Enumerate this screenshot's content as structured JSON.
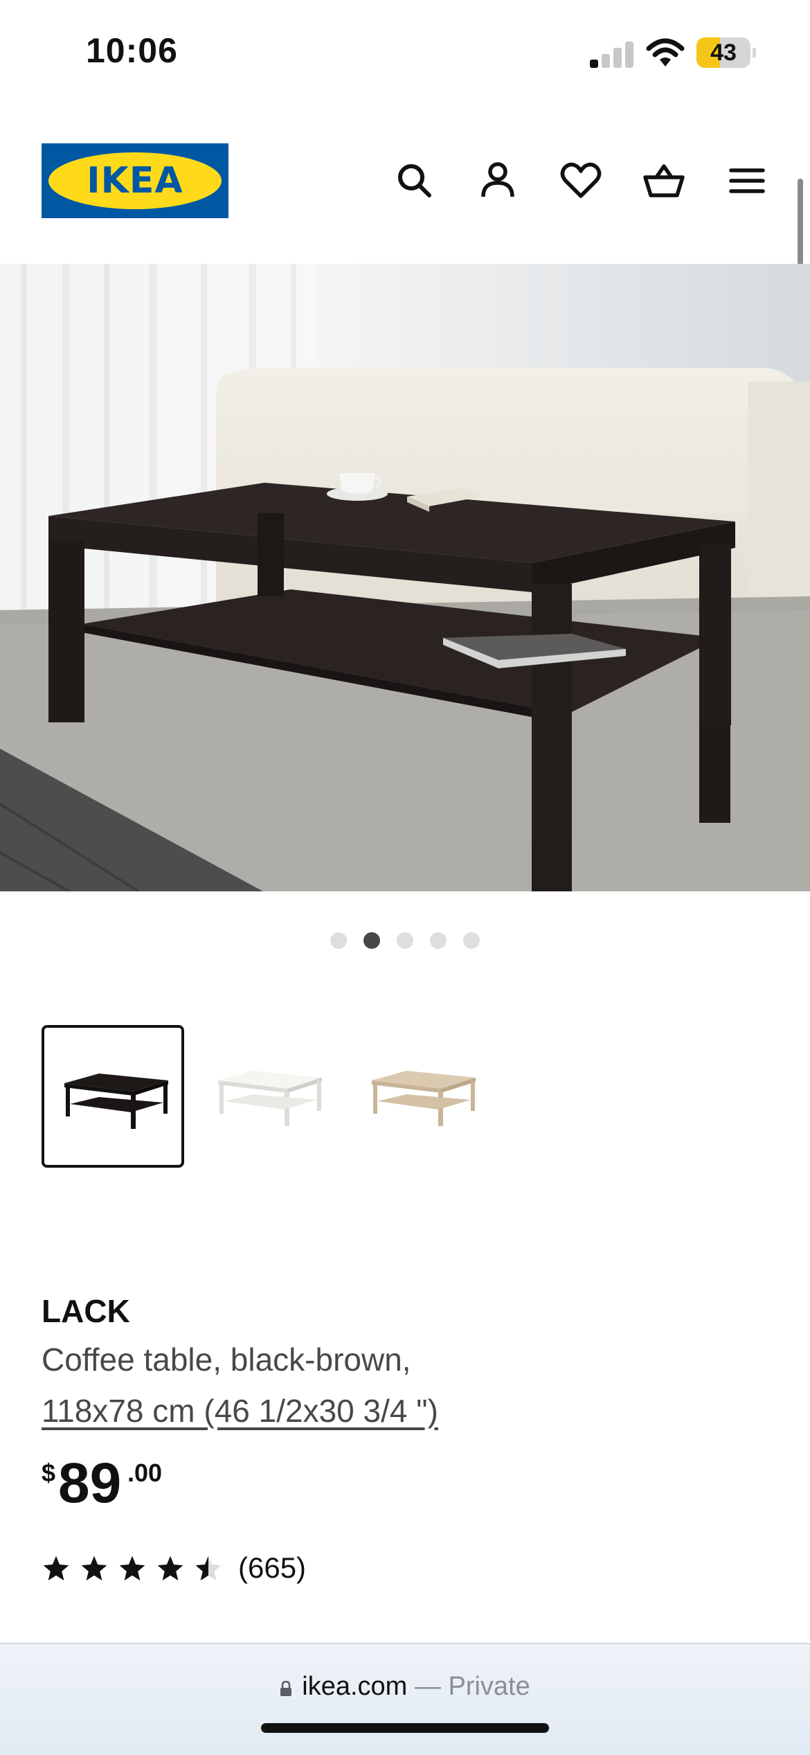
{
  "status_bar": {
    "time": "10:06",
    "battery_percent": "43",
    "signal_bars_active": 1,
    "battery_level": 0.43
  },
  "header": {
    "logo_text": "IKEA",
    "colors": {
      "brand_blue": "#0058a3",
      "brand_yellow": "#ffda1a"
    },
    "icons": [
      "search-icon",
      "account-icon",
      "wishlist-heart-icon",
      "cart-basket-icon",
      "menu-icon"
    ]
  },
  "gallery": {
    "image_count": 5,
    "active_index": 1
  },
  "variants": [
    {
      "name": "black-brown",
      "color": "#2a2421",
      "selected": true
    },
    {
      "name": "white",
      "color": "#f2f0ea",
      "selected": false
    },
    {
      "name": "white stained oak",
      "color": "#d8c4a8",
      "selected": false
    }
  ],
  "product": {
    "name": "LACK",
    "description": "Coffee table, black-brown,",
    "size": "118x78 cm (46 1/2x30 3/4 \")",
    "price": {
      "currency": "$",
      "integer": "89",
      "decimal": ".00"
    },
    "rating": {
      "value": 4.5,
      "max": 5,
      "count_text": "(665)"
    }
  },
  "browser": {
    "domain": "ikea.com",
    "separator": " — ",
    "mode": "Private"
  }
}
